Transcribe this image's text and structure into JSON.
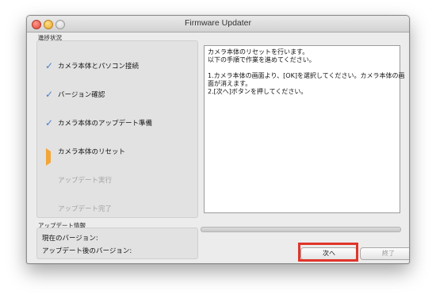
{
  "window": {
    "title": "Firmware Updater"
  },
  "progress_group": {
    "label": "進捗状況"
  },
  "steps": [
    {
      "label": "カメラ本体とパソコン接続",
      "state": "done",
      "icon": "checkmark-icon"
    },
    {
      "label": "バージョン確認",
      "state": "done",
      "icon": "checkmark-icon"
    },
    {
      "label": "カメラ本体のアップデート準備",
      "state": "done",
      "icon": "checkmark-icon"
    },
    {
      "label": "カメラ本体のリセット",
      "state": "current",
      "icon": "arrow-right-icon"
    },
    {
      "label": "アップデート実行",
      "state": "pending",
      "icon": ""
    },
    {
      "label": "アップデート完了",
      "state": "pending",
      "icon": ""
    }
  ],
  "message": {
    "lines": [
      "カメラ本体のリセットを行います。",
      "以下の手順で作業を進めてください。",
      "",
      "1.カメラ本体の画面より、[OK]を選択してください。カメラ本体の画",
      "面が消えます。",
      "2.[次へ]ボタンを押してください。"
    ]
  },
  "info_group": {
    "label": "アップデート情報",
    "current_version_label": "現在のバージョン:",
    "after_version_label": "アップデート後のバージョン:"
  },
  "buttons": {
    "next": "次へ",
    "exit": "終了"
  },
  "colors": {
    "highlight": "#e0352b",
    "check": "#4a7fc8",
    "current_arrow": "#f2a63a"
  }
}
